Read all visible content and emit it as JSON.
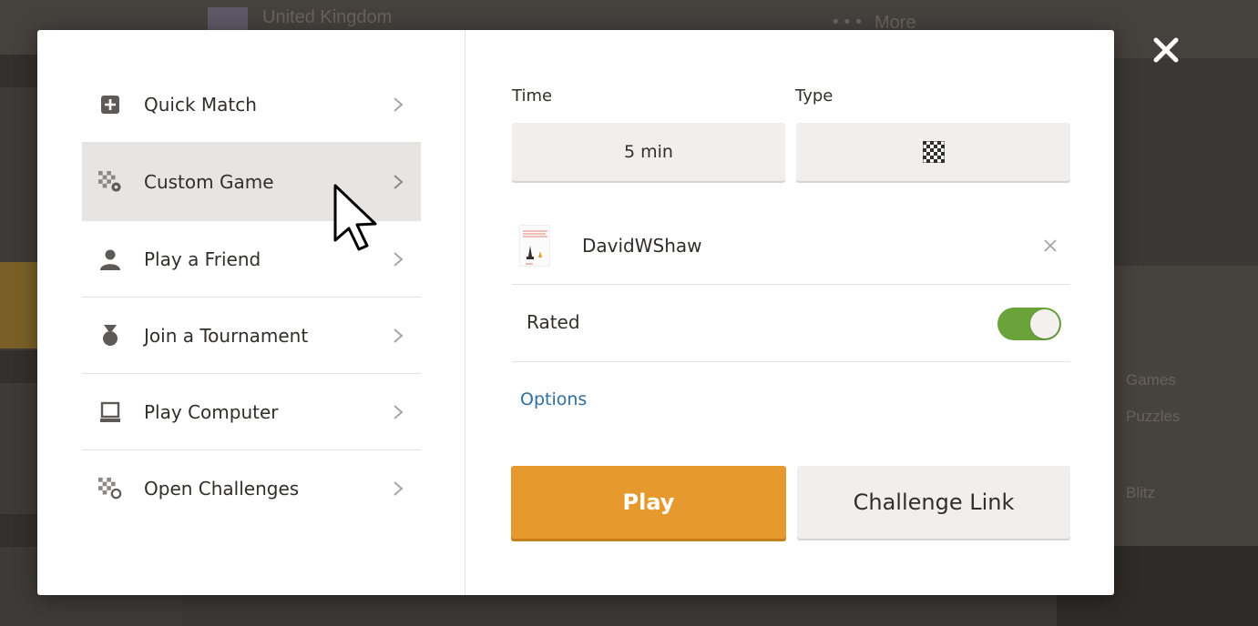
{
  "background": {
    "country": "United Kingdom",
    "more_label": "More",
    "games_label": "Games",
    "puzzles_label": "Puzzles",
    "blitz_label": "Blitz"
  },
  "menu": {
    "items": [
      {
        "label": "Quick Match",
        "icon": "plus-square-icon",
        "active": false
      },
      {
        "label": "Custom Game",
        "icon": "board-gear-icon",
        "active": true
      },
      {
        "label": "Play a Friend",
        "icon": "person-icon",
        "active": false
      },
      {
        "label": "Join a Tournament",
        "icon": "medal-icon",
        "active": false
      },
      {
        "label": "Play Computer",
        "icon": "computer-icon",
        "active": false
      },
      {
        "label": "Open Challenges",
        "icon": "board-circle-icon",
        "active": false
      }
    ]
  },
  "settings": {
    "time_label": "Time",
    "time_value": "5 min",
    "type_label": "Type",
    "type_icon": "checkerboard-icon",
    "opponent_name": "DavidWShaw",
    "rated_label": "Rated",
    "rated_on": true,
    "options_label": "Options",
    "play_label": "Play",
    "challenge_link_label": "Challenge Link"
  },
  "colors": {
    "accent_orange": "#e69a2d",
    "toggle_green": "#69a33a",
    "link_blue": "#2f6fa1",
    "active_item_bg": "#e6e5e4"
  }
}
